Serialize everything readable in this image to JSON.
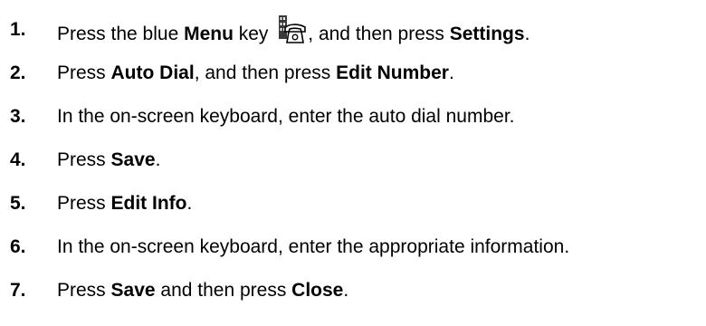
{
  "steps": [
    {
      "number": "1.",
      "parts": [
        {
          "t": "Press the blue "
        },
        {
          "b": "Menu"
        },
        {
          "t": " key "
        },
        {
          "icon": "menu-key-icon"
        },
        {
          "t": ", and then press "
        },
        {
          "b": "Settings"
        },
        {
          "t": "."
        }
      ]
    },
    {
      "number": "2.",
      "parts": [
        {
          "t": "Press "
        },
        {
          "b": "Auto Dial"
        },
        {
          "t": ", and then press "
        },
        {
          "b": "Edit Number"
        },
        {
          "t": "."
        }
      ]
    },
    {
      "number": "3.",
      "parts": [
        {
          "t": "In the on-screen keyboard, enter the auto dial number."
        }
      ]
    },
    {
      "number": "4.",
      "parts": [
        {
          "t": "Press "
        },
        {
          "b": "Save"
        },
        {
          "t": "."
        }
      ]
    },
    {
      "number": "5.",
      "parts": [
        {
          "t": "Press "
        },
        {
          "b": "Edit Info"
        },
        {
          "t": "."
        }
      ]
    },
    {
      "number": "6.",
      "parts": [
        {
          "t": "In the on-screen keyboard, enter the appropriate information."
        }
      ]
    },
    {
      "number": "7.",
      "parts": [
        {
          "t": "Press "
        },
        {
          "b": "Save"
        },
        {
          "t": " and then press "
        },
        {
          "b": "Close"
        },
        {
          "t": "."
        }
      ]
    }
  ]
}
